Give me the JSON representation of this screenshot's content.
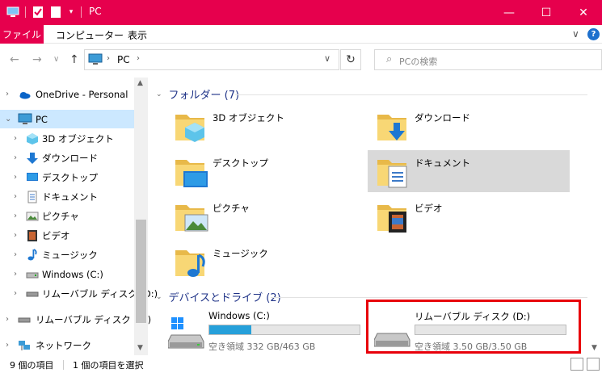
{
  "window": {
    "title": "PC",
    "minimize": "—",
    "maximize": "☐",
    "close": "✕"
  },
  "ribbon": {
    "file_tab": "ファイル",
    "tabs": [
      "コンピューター",
      "表示"
    ],
    "expand": "∨",
    "help": "?"
  },
  "nav": {
    "back": "←",
    "forward": "→",
    "recent": "∨",
    "up": "↑",
    "breadcrumb": [
      "PC"
    ],
    "sep": "›",
    "dropdown": "∨",
    "refresh": "↻",
    "search_placeholder": "PCの検索",
    "search_icon": "search-icon"
  },
  "sidebar": {
    "items": [
      {
        "label": "OneDrive - Personal",
        "icon": "onedrive-icon"
      },
      {
        "label": "PC",
        "icon": "pc-icon"
      },
      {
        "label": "3D オブジェクト",
        "icon": "3d-objects-icon"
      },
      {
        "label": "ダウンロード",
        "icon": "download-icon"
      },
      {
        "label": "デスクトップ",
        "icon": "desktop-icon"
      },
      {
        "label": "ドキュメント",
        "icon": "documents-icon"
      },
      {
        "label": "ピクチャ",
        "icon": "pictures-icon"
      },
      {
        "label": "ビデオ",
        "icon": "videos-icon"
      },
      {
        "label": "ミュージック",
        "icon": "music-icon"
      },
      {
        "label": "Windows (C:)",
        "icon": "drive-icon"
      },
      {
        "label": "リムーバブル ディスク (D:)",
        "icon": "removable-drive-icon"
      },
      {
        "label": "リムーバブル ディスク (D:)",
        "icon": "removable-drive-icon"
      },
      {
        "label": "ネットワーク",
        "icon": "network-icon"
      }
    ]
  },
  "main": {
    "folders_header": "フォルダー (7)",
    "folders": [
      {
        "label": "3D オブジェクト",
        "icon": "3d-objects-folder-icon"
      },
      {
        "label": "ダウンロード",
        "icon": "download-folder-icon"
      },
      {
        "label": "デスクトップ",
        "icon": "desktop-folder-icon"
      },
      {
        "label": "ドキュメント",
        "icon": "documents-folder-icon"
      },
      {
        "label": "ピクチャ",
        "icon": "pictures-folder-icon"
      },
      {
        "label": "ビデオ",
        "icon": "videos-folder-icon"
      },
      {
        "label": "ミュージック",
        "icon": "music-folder-icon"
      }
    ],
    "drives_header": "デバイスとドライブ (2)",
    "drives": [
      {
        "name": "Windows (C:)",
        "free": "空き領域 332 GB/463 GB",
        "used_fraction": 0.28
      },
      {
        "name": "リムーバブル ディスク (D:)",
        "free": "空き領域 3.50 GB/3.50 GB",
        "used_fraction": 0.0
      }
    ]
  },
  "status": {
    "item_count": "9 個の項目",
    "selected": "1 個の項目を選択"
  },
  "colors": {
    "titlebar": "#e6004d",
    "selection": "#cce8ff",
    "header_text": "#1e3287",
    "highlight_box": "#e8000b",
    "bar_fill": "#26a0da"
  }
}
